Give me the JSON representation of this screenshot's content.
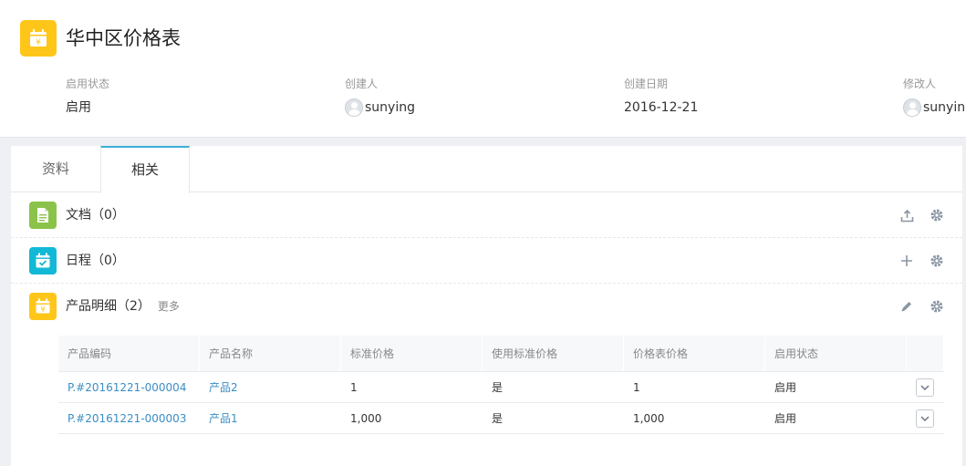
{
  "header": {
    "title": "华中区价格表",
    "fields": [
      {
        "label": "启用状态",
        "value": "启用",
        "avatar": false
      },
      {
        "label": "创建人",
        "value": "sunying",
        "avatar": true
      },
      {
        "label": "创建日期",
        "value": "2016-12-21",
        "avatar": false
      },
      {
        "label": "修改人",
        "value": "sunying",
        "avatar": true
      }
    ]
  },
  "tabs": [
    {
      "label": "资料",
      "active": false
    },
    {
      "label": "相关",
      "active": true
    }
  ],
  "sections": {
    "docs": {
      "title": "文档（0）",
      "icon": "document-icon",
      "color": "#8bc34a"
    },
    "schedule": {
      "title": "日程（0）",
      "icon": "calendar-icon",
      "color": "#12b9d6"
    },
    "products": {
      "title": "产品明细（2）",
      "more": "更多",
      "icon": "price-tag-icon",
      "color": "#ffc61a"
    }
  },
  "table": {
    "headers": [
      "产品编码",
      "产品名称",
      "标准价格",
      "使用标准价格",
      "价格表价格",
      "启用状态"
    ],
    "rows": [
      {
        "code": "P.#20161221-000004",
        "name": "产品2",
        "std_price": "1",
        "use_std": "是",
        "list_price": "1",
        "status": "启用"
      },
      {
        "code": "P.#20161221-000003",
        "name": "产品1",
        "std_price": "1,000",
        "use_std": "是",
        "list_price": "1,000",
        "status": "启用"
      }
    ]
  },
  "colors": {
    "accent": "#3dafd8",
    "link": "#3a8ec4",
    "brand_yellow": "#ffc61a"
  }
}
